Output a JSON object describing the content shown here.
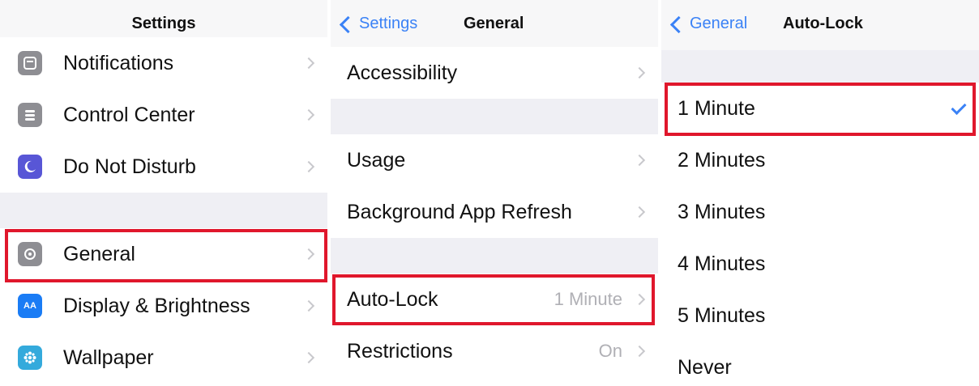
{
  "panel_settings": {
    "title": "Settings",
    "items": [
      {
        "label": "Notifications",
        "icon": "notifications-icon",
        "icon_color": "#8e8e93"
      },
      {
        "label": "Control Center",
        "icon": "control-center-icon",
        "icon_color": "#8e8e93"
      },
      {
        "label": "Do Not Disturb",
        "icon": "moon-icon",
        "icon_color": "#5856d6"
      },
      {
        "label": "General",
        "icon": "gear-icon",
        "icon_color": "#8e8e93"
      },
      {
        "label": "Display & Brightness",
        "icon": "display-brightness-icon",
        "icon_glyph": "AA",
        "icon_color": "#1a7cf5"
      },
      {
        "label": "Wallpaper",
        "icon": "wallpaper-icon",
        "icon_color": "#34aadc"
      }
    ]
  },
  "panel_general": {
    "back_label": "Settings",
    "title": "General",
    "items": [
      {
        "label": "Accessibility"
      },
      {
        "label": "Usage"
      },
      {
        "label": "Background App Refresh"
      },
      {
        "label": "Auto-Lock",
        "value": "1 Minute"
      },
      {
        "label": "Restrictions",
        "value": "On"
      }
    ]
  },
  "panel_autolock": {
    "back_label": "General",
    "title": "Auto-Lock",
    "options": [
      {
        "label": "1 Minute",
        "selected": true
      },
      {
        "label": "2 Minutes"
      },
      {
        "label": "3 Minutes"
      },
      {
        "label": "4 Minutes"
      },
      {
        "label": "5 Minutes"
      },
      {
        "label": "Never"
      }
    ]
  },
  "colors": {
    "highlight": "#e0172c",
    "accent": "#3b82f6"
  }
}
